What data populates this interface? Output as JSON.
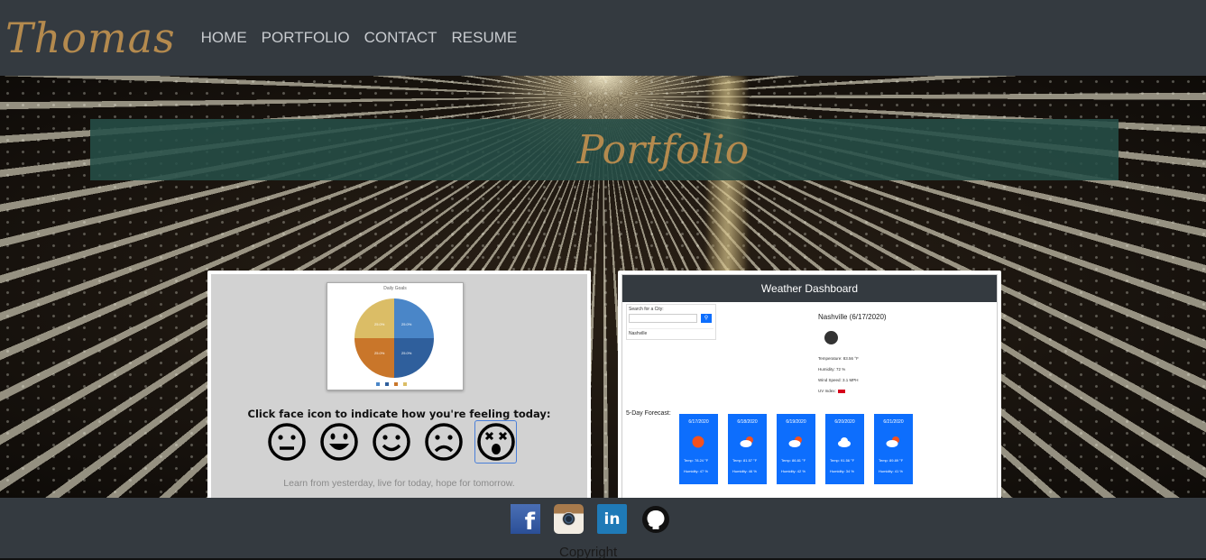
{
  "navbar": {
    "brand": "Thomas",
    "links": [
      {
        "label": "HOME"
      },
      {
        "label": "PORTFOLIO"
      },
      {
        "label": "CONTACT"
      },
      {
        "label": "RESUME"
      }
    ]
  },
  "hero": {
    "title": "Portfolio"
  },
  "projects": {
    "mood": {
      "chart_title": "Daily Goals",
      "pie_labels": [
        "25.0%",
        "25.0%",
        "25.0%",
        "25.0%"
      ],
      "prompt": "Click face icon to indicate how you're feeling today:",
      "faces": [
        "neutral-face-icon",
        "grinning-face-icon",
        "smiling-face-icon",
        "frowning-face-icon",
        "dizzy-face-icon"
      ],
      "quote": "Learn from yesterday, live for today, hope for tomorrow."
    },
    "weather": {
      "header": "Weather Dashboard",
      "search_label": "Search for a City:",
      "search_city": "Nashville",
      "current_title": "Nashville (6/17/2020)",
      "temperature": "Temperature: 83.56 °F",
      "humidity": "Humidity: 72 %",
      "wind": "Wind Speed: 3.1 MPH",
      "uv": "UV Index:",
      "forecast_label": "5-Day Forecast:",
      "forecast": [
        {
          "date": "6/17/2020",
          "temp": "Temp: 78.24 °F",
          "humidity": "Humidity: 47 %",
          "icon": "sun-icon"
        },
        {
          "date": "6/18/2020",
          "temp": "Temp: 81.57 °F",
          "humidity": "Humidity: 46 %",
          "icon": "partly-cloudy-icon"
        },
        {
          "date": "6/19/2020",
          "temp": "Temp: 86.81 °F",
          "humidity": "Humidity: 42 %",
          "icon": "partly-cloudy-icon"
        },
        {
          "date": "6/20/2020",
          "temp": "Temp: 91.56 °F",
          "humidity": "Humidity: 34 %",
          "icon": "cloud-icon"
        },
        {
          "date": "6/21/2020",
          "temp": "Temp: 89.89 °F",
          "humidity": "Humidity: 41 %",
          "icon": "partly-cloudy-icon"
        }
      ]
    }
  },
  "footer": {
    "socials": [
      "facebook-icon",
      "instagram-icon",
      "linkedin-icon",
      "github-icon"
    ],
    "facebook_glyph": "f",
    "linkedin_glyph": "in",
    "copyright": "Copyright"
  },
  "colors": {
    "nav_bg": "#343a40",
    "brand_gold": "#b48a4e",
    "title_band": "#264e48",
    "forecast_blue": "#0d6efd"
  }
}
